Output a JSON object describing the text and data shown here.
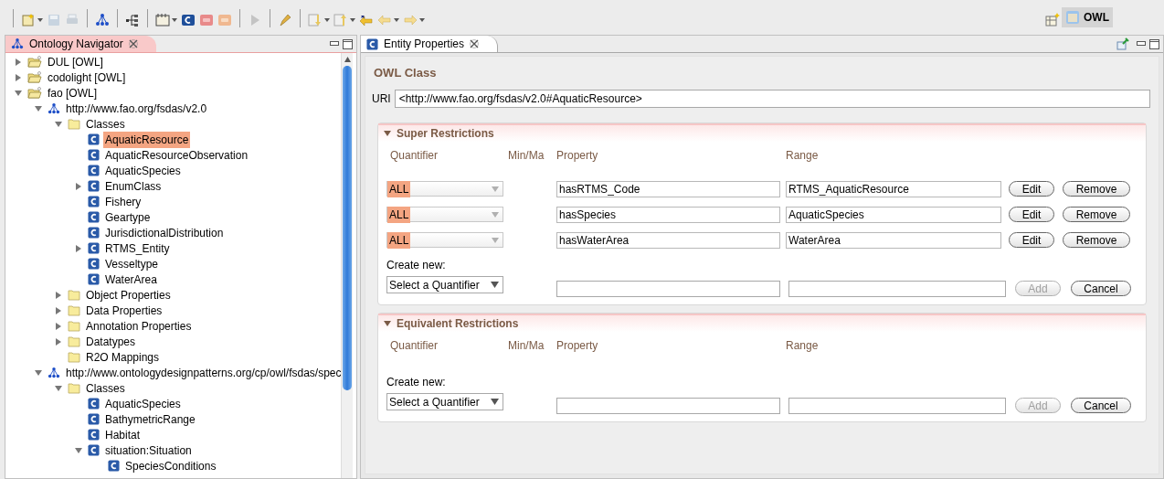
{
  "perspective": {
    "label": "OWL",
    "selected": true
  },
  "navigator": {
    "title": "Ontology Navigator",
    "tree": [
      {
        "label": "DUL [OWL]",
        "kind": "project",
        "expanded": false,
        "selected": false
      },
      {
        "label": "codolight [OWL]",
        "kind": "project",
        "expanded": false,
        "selected": false
      },
      {
        "label": "fao [OWL]",
        "kind": "project",
        "expanded": true,
        "selected": false,
        "children": [
          {
            "label": "http://www.fao.org/fsdas/v2.0",
            "kind": "ontology",
            "expanded": true,
            "selected": false,
            "children": [
              {
                "label": "Classes",
                "kind": "folder",
                "expanded": true,
                "selected": false,
                "children": [
                  {
                    "label": "AquaticResource",
                    "kind": "class",
                    "selected": true
                  },
                  {
                    "label": "AquaticResourceObservation",
                    "kind": "class",
                    "selected": false
                  },
                  {
                    "label": "AquaticSpecies",
                    "kind": "class",
                    "selected": false
                  },
                  {
                    "label": "EnumClass",
                    "kind": "class",
                    "expanded": false,
                    "selected": false
                  },
                  {
                    "label": "Fishery",
                    "kind": "class",
                    "selected": false
                  },
                  {
                    "label": "Geartype",
                    "kind": "class",
                    "selected": false
                  },
                  {
                    "label": "JurisdictionalDistribution",
                    "kind": "class",
                    "selected": false
                  },
                  {
                    "label": "RTMS_Entity",
                    "kind": "class",
                    "expanded": false,
                    "selected": false
                  },
                  {
                    "label": "Vesseltype",
                    "kind": "class",
                    "selected": false
                  },
                  {
                    "label": "WaterArea",
                    "kind": "class",
                    "selected": false
                  }
                ]
              },
              {
                "label": "Object Properties",
                "kind": "folder",
                "expanded": false,
                "selected": false
              },
              {
                "label": "Data Properties",
                "kind": "folder",
                "expanded": false,
                "selected": false
              },
              {
                "label": "Annotation Properties",
                "kind": "folder",
                "expanded": false,
                "selected": false
              },
              {
                "label": "Datatypes",
                "kind": "folder",
                "expanded": false,
                "selected": false
              },
              {
                "label": "R2O Mappings",
                "kind": "folder",
                "selected": false
              }
            ]
          },
          {
            "label": "http://www.ontologydesignpatterns.org/cp/owl/fsdas/spec",
            "kind": "ontology",
            "expanded": true,
            "selected": false,
            "children": [
              {
                "label": "Classes",
                "kind": "folder",
                "expanded": true,
                "selected": false,
                "children": [
                  {
                    "label": "AquaticSpecies",
                    "kind": "class",
                    "selected": false
                  },
                  {
                    "label": "BathymetricRange",
                    "kind": "class",
                    "selected": false
                  },
                  {
                    "label": "Habitat",
                    "kind": "class",
                    "selected": false
                  },
                  {
                    "label": "situation:Situation",
                    "kind": "class",
                    "expanded": true,
                    "selected": false,
                    "children": [
                      {
                        "label": "SpeciesConditions",
                        "kind": "class",
                        "selected": false
                      }
                    ]
                  }
                ]
              }
            ]
          }
        ]
      }
    ]
  },
  "entity": {
    "title": "Entity Properties",
    "heading": "OWL Class",
    "uri_label": "URI",
    "uri": "<http://www.fao.org/fsdas/v2.0#AquaticResource>",
    "sections": [
      {
        "title": "Super Restrictions",
        "expanded": true,
        "columns": [
          "Quantifier",
          "Min/Ma",
          "Property",
          "Range"
        ],
        "rows": [
          {
            "quantifier": "ALL",
            "property": "hasRTMS_Code",
            "range": "RTMS_AquaticResource",
            "edit": "Edit",
            "remove": "Remove"
          },
          {
            "quantifier": "ALL",
            "property": "hasSpecies",
            "range": "AquaticSpecies",
            "edit": "Edit",
            "remove": "Remove"
          },
          {
            "quantifier": "ALL",
            "property": "hasWaterArea",
            "range": "WaterArea",
            "edit": "Edit",
            "remove": "Remove"
          }
        ],
        "create_label": "Create new:",
        "create_quantifier": "Select a Quantifier",
        "add": {
          "label": "Add",
          "disabled": true
        },
        "cancel": "Cancel"
      },
      {
        "title": "Equivalent Restrictions",
        "expanded": true,
        "columns": [
          "Quantifier",
          "Min/Ma",
          "Property",
          "Range"
        ],
        "create_label": "Create new:",
        "create_quantifier": "Select a Quantifier",
        "add": {
          "label": "Add",
          "disabled": true
        },
        "cancel": "Cancel"
      }
    ]
  }
}
